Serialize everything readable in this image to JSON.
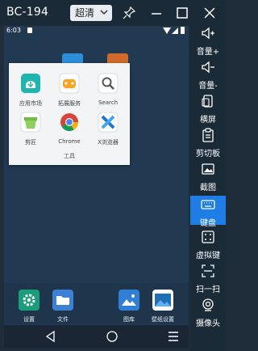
{
  "window": {
    "title": "BC-194",
    "quality_label": "超清",
    "colors": {
      "titlebar": "#1b2a37",
      "accent": "#1f7ee6"
    }
  },
  "status": {
    "time": "6:03"
  },
  "popup": {
    "apps": [
      {
        "label": "应用市场",
        "icon": "app-market-icon"
      },
      {
        "label": "拓展服务",
        "icon": "extension-service-icon"
      },
      {
        "label": "Search",
        "icon": "search-icon"
      },
      {
        "label": "剪匠",
        "icon": "jianjiang-icon"
      },
      {
        "label": "Chrome",
        "icon": "chrome-icon"
      },
      {
        "label": "X浏览器",
        "icon": "x-browser-icon"
      }
    ],
    "folder_name": "工具"
  },
  "dock": {
    "apps": [
      {
        "label": "设置",
        "icon": "settings-icon"
      },
      {
        "label": "文件",
        "icon": "files-icon"
      },
      {
        "label": "图库",
        "icon": "gallery-icon"
      },
      {
        "label": "壁纸设置",
        "icon": "wallpaper-icon"
      }
    ]
  },
  "sidebar": {
    "items": [
      {
        "label": "音量+",
        "icon": "volume-up-icon"
      },
      {
        "label": "音量-",
        "icon": "volume-down-icon"
      },
      {
        "label": "横屏",
        "icon": "rotate-icon"
      },
      {
        "label": "剪切板",
        "icon": "clipboard-icon"
      },
      {
        "label": "截图",
        "icon": "screenshot-icon"
      },
      {
        "label": "键盘",
        "icon": "keyboard-icon",
        "active": true
      },
      {
        "label": "虚拟键",
        "icon": "virtual-keys-icon"
      },
      {
        "label": "扫一扫",
        "icon": "scan-icon"
      },
      {
        "label": "摄像头",
        "icon": "camera-icon"
      }
    ]
  }
}
